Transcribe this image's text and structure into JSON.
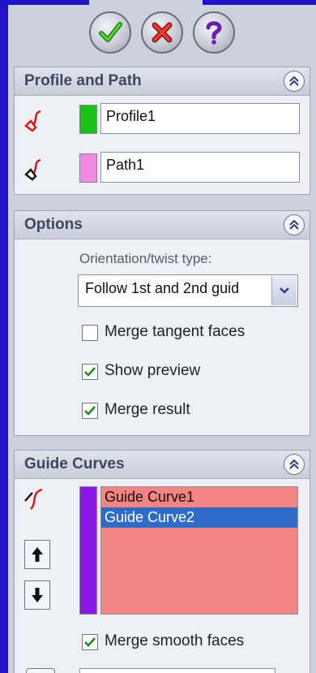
{
  "toolbar": {
    "ok_icon": "checkmark-icon",
    "cancel_icon": "x-icon",
    "help_icon": "question-icon"
  },
  "profile_path": {
    "title": "Profile and Path",
    "profile_value": "Profile1",
    "profile_color": "#19c219",
    "path_value": "Path1",
    "path_color": "#f08ae6"
  },
  "options": {
    "title": "Options",
    "orientation_label": "Orientation/twist type:",
    "orientation_value": "Follow 1st and 2nd guid",
    "merge_tangent_label": "Merge tangent faces",
    "merge_tangent_checked": false,
    "show_preview_label": "Show preview",
    "show_preview_checked": true,
    "merge_result_label": "Merge result",
    "merge_result_checked": true
  },
  "guide_curves": {
    "title": "Guide Curves",
    "color": "#8a19e6",
    "items": [
      "Guide Curve1",
      "Guide Curve2"
    ],
    "selected_index": 1,
    "merge_smooth_label": "Merge smooth faces",
    "merge_smooth_checked": true
  }
}
